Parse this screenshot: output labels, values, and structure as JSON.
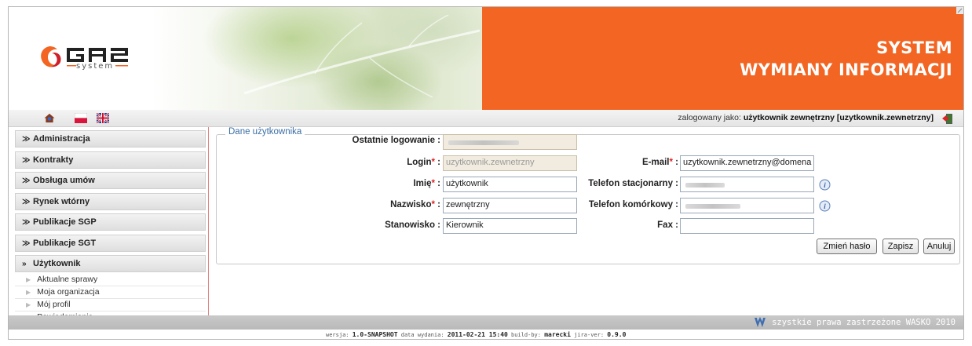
{
  "header": {
    "logo_text": "GAZ",
    "logo_sub": "system",
    "system_title_line1": "SYSTEM",
    "system_title_line2": "WYMIANY INFORMACJI"
  },
  "topbar": {
    "logged_prefix": "zalogowany jako:",
    "logged_user": "użytkownik zewnętrzny [uzytkownik.zewnetrzny]",
    "icons": [
      "home-icon",
      "flag-pl-icon",
      "flag-uk-icon",
      "logout-icon"
    ]
  },
  "sidebar": {
    "items": [
      {
        "label": "Administracja",
        "chevron": "≫"
      },
      {
        "label": "Kontrakty",
        "chevron": "≫"
      },
      {
        "label": "Obsługa umów",
        "chevron": "≫"
      },
      {
        "label": "Rynek wtórny",
        "chevron": "≫"
      },
      {
        "label": "Publikacje SGP",
        "chevron": "≫"
      },
      {
        "label": "Publikacje SGT",
        "chevron": "≫"
      },
      {
        "label": "Użytkownik",
        "chevron": "»"
      }
    ],
    "subitems": [
      "Aktualne sprawy",
      "Moja organizacja",
      "Mój profil",
      "Powiadomienia"
    ]
  },
  "form": {
    "legend": "Dane użytkownika",
    "last_login_label": "Ostatnie logowanie :",
    "login_label": "Login",
    "login_value": "uzytkownik.zewnetrzny",
    "imie_label": "Imię",
    "imie_value": "użytkownik",
    "nazwisko_label": "Nazwisko",
    "nazwisko_value": "zewnętrzny",
    "stanowisko_label": "Stanowisko :",
    "stanowisko_value": "Kierownik",
    "email_label": "E-mail",
    "email_value": "uzytkownik.zewnetrzny@domena",
    "tel_stac_label": "Telefon stacjonarny :",
    "tel_kom_label": "Telefon komórkowy :",
    "fax_label": "Fax :",
    "required_mark": "*",
    "colon": " :"
  },
  "buttons": {
    "change_password": "Zmień hasło",
    "save": "Zapisz",
    "cancel": "Anuluj"
  },
  "footer": {
    "rights": "szystkie prawa zastrzeżone WASKO 2010",
    "version_label": "wersja:",
    "version_value": "1.0-SNAPSHOT",
    "release_label": "data wydania:",
    "release_value": "2011-02-21 15:40",
    "build_label": "build-by:",
    "build_value": "marecki",
    "jira_label": "jira-ver:",
    "jira_value": "0.9.0"
  },
  "colors": {
    "accent_orange": "#f26522",
    "legend_blue": "#3b6ea5",
    "required_red": "#dd2222"
  }
}
